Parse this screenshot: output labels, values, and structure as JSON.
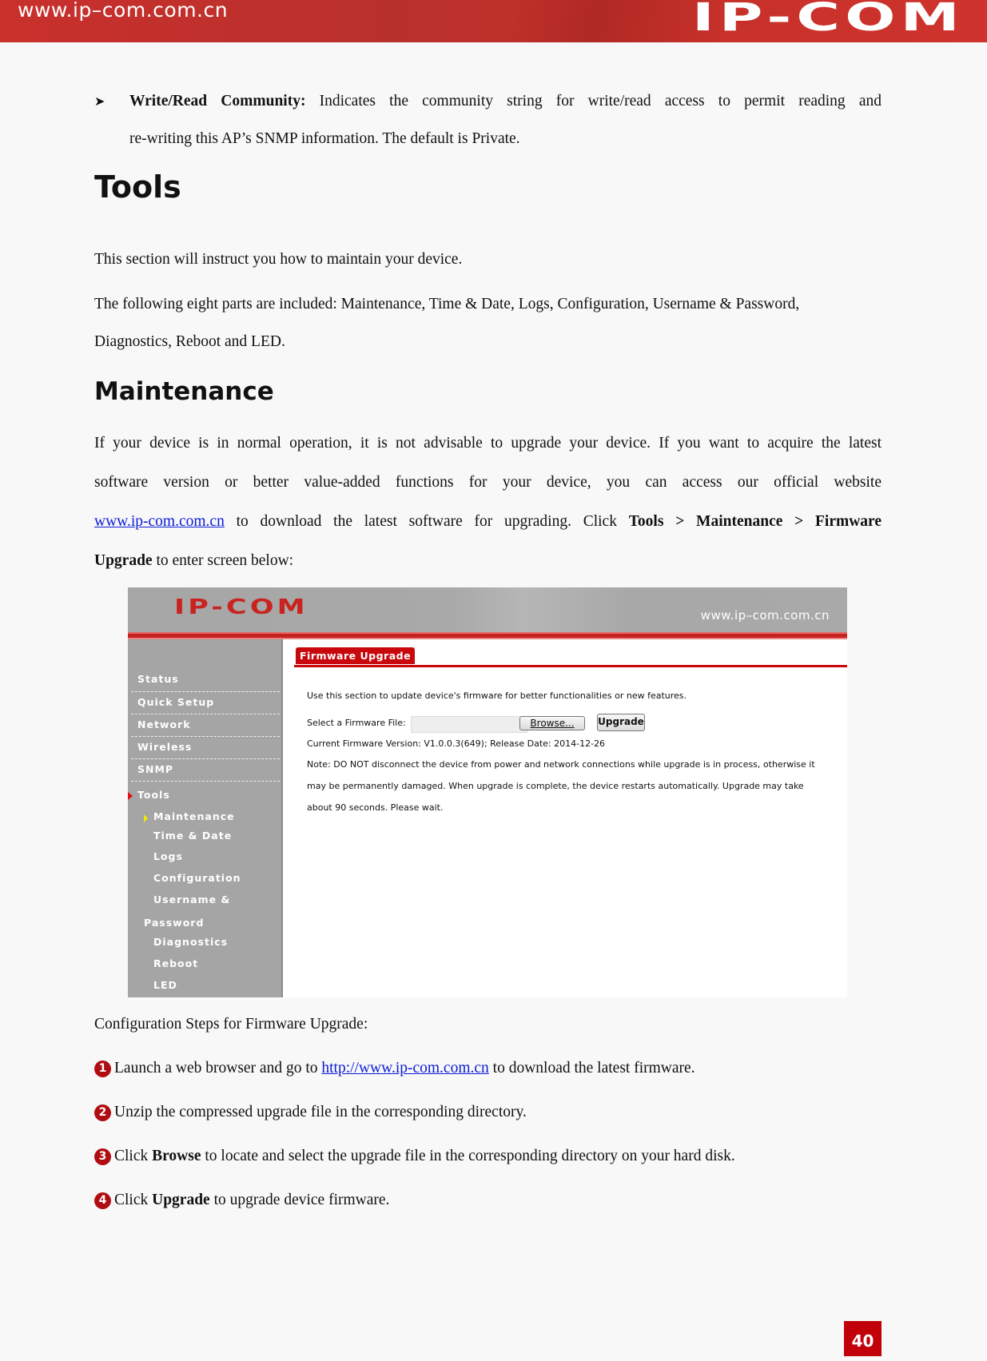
{
  "header": {
    "url": "www.ip–com.com.cn",
    "brand": "IP-COM"
  },
  "bullet": {
    "term": "Write/Read Community:",
    "line1": " Indicates the community string for write/read access to permit reading and",
    "line2": "re-writing this AP’s SNMP information. The default is Private."
  },
  "tools_section": {
    "heading": "Tools",
    "intro": "This section will instruct you how to maintain your device.",
    "parts_line1": "The following eight parts are included: Maintenance, Time & Date, Logs, Configuration, Username & Password,",
    "parts_line2": "Diagnostics, Reboot and LED."
  },
  "maintenance_section": {
    "heading": "Maintenance",
    "para_line1": "If your device is in normal operation, it is not advisable to upgrade your device. If you want to acquire the latest",
    "para_line2": "software version or better value-added functions for your device, you can access our official website",
    "link_text": "www.ip-com.com.cn",
    "para_line3_mid": " to download the latest software for upgrading. Click ",
    "para_line3_bold": "Tools > Maintenance > Firmware",
    "para_line4_bold": "Upgrade",
    "para_line4_rest": " to enter screen below:"
  },
  "screenshot": {
    "logo": "IP-COM",
    "url": "www.ip–com.com.cn",
    "nav": {
      "main_items": [
        "Status",
        "Quick Setup",
        "Network",
        "Wireless",
        "SNMP",
        "Tools"
      ],
      "tools_sub_items": [
        "Maintenance",
        "Time & Date",
        "Logs",
        "Configuration",
        "Username &",
        "Password",
        "Diagnostics",
        "Reboot",
        "LED"
      ],
      "active_main": "Tools",
      "active_sub": "Maintenance"
    },
    "tab_label": "Firmware Upgrade",
    "description": "Use this section to update device's firmware for better functionalities or new features.",
    "file_label": "Select a Firmware File:",
    "file_value": "",
    "browse_label": "Browse...",
    "upgrade_label": "Upgrade",
    "version_text": "Current Firmware Version: V1.0.0.3(649); Release Date: 2014-12-26",
    "note_line1": "Note: DO NOT disconnect the device from power and network connections while upgrade is in process, otherwise it",
    "note_line2": "may be permanently damaged. When upgrade is complete, the device restarts automatically. Upgrade may take",
    "note_line3": "about 90 seconds. Please wait."
  },
  "steps": {
    "title": "Configuration Steps for Firmware Upgrade:",
    "items": [
      {
        "num": "1",
        "pre": "Launch a web browser and go to ",
        "link": "http://www.ip-com.com.cn",
        "post": " to download the latest firmware."
      },
      {
        "num": "2",
        "pre": "Unzip the compressed upgrade file in the corresponding directory."
      },
      {
        "num": "3",
        "pre": "Click ",
        "bold": "Browse",
        "post": " to locate and select the upgrade file in the corresponding directory on your hard disk."
      },
      {
        "num": "4",
        "pre": "Click ",
        "bold": "Upgrade",
        "post": " to upgrade device firmware."
      }
    ]
  },
  "footer": {
    "page_number": "40"
  },
  "colors": {
    "brand_red": "#c8302c",
    "link_blue": "#0b1bd6",
    "step_badge": "#b00d12"
  }
}
